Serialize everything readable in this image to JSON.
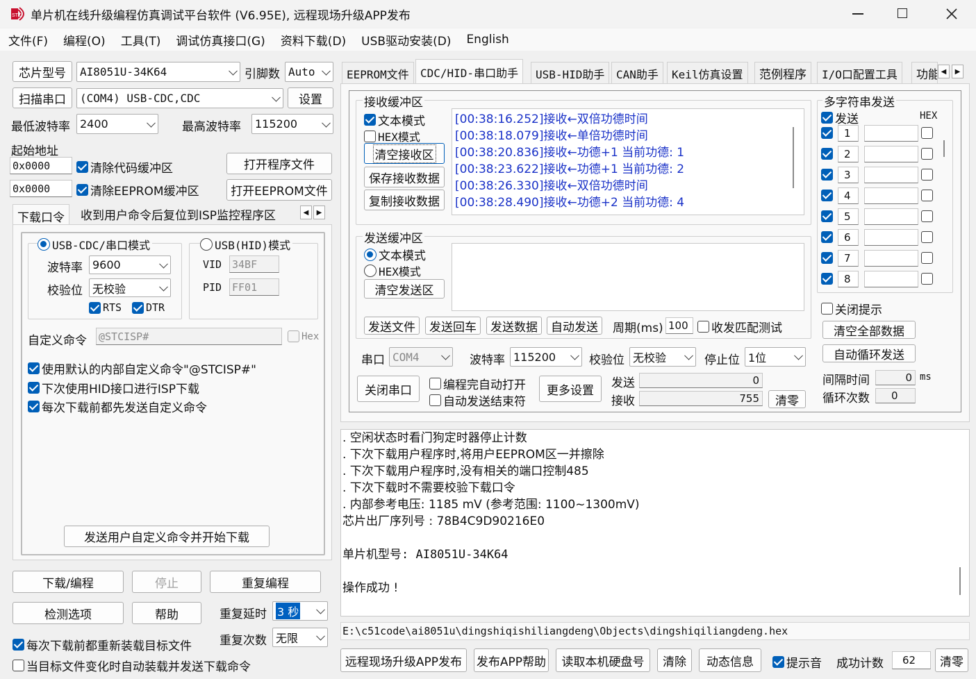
{
  "window": {
    "title": "单片机在线升级编程仿真调试平台软件 (V6.95E), 远程现场升级APP发布"
  },
  "menu": [
    "文件(F)",
    "编程(O)",
    "工具(T)",
    "调试仿真接口(G)",
    "资料下载(D)",
    "USB驱动安装(D)",
    "English"
  ],
  "left": {
    "chip_label": "芯片型号",
    "chip_value": "AI8051U-34K64",
    "pins_label": "引脚数",
    "pins_value": "Auto",
    "scan_btn": "扫描串口",
    "port_value": "(COM4) USB-CDC,CDC",
    "settings_btn": "设置",
    "min_baud_label": "最低波特率",
    "min_baud_value": "2400",
    "max_baud_label": "最高波特率",
    "max_baud_value": "115200",
    "start_addr_label": "起始地址",
    "addr1": "0x0000",
    "addr2": "0x0000",
    "clear_code": "清除代码缓冲区",
    "clear_eeprom": "清除EEPROM缓冲区",
    "open_prog_btn": "打开程序文件",
    "open_eeprom_btn": "打开EEPROM文件",
    "tabs": [
      "下载口令",
      "收到用户命令后复位到ISP监控程序区"
    ],
    "usb_cdc_mode": "USB-CDC/串口模式",
    "usb_hid_mode": "USB(HID)模式",
    "baud_label": "波特率",
    "baud_value": "9600",
    "parity_label": "校验位",
    "parity_value": "无校验",
    "rts": "RTS",
    "dtr": "DTR",
    "vid_label": "VID",
    "vid_value": "34BF",
    "pid_label": "PID",
    "pid_value": "FF01",
    "custom_cmd_label": "自定义命令",
    "custom_cmd_value": "@STCISP#",
    "hex_label": "Hex",
    "opt1": "使用默认的内部自定义命令\"@STCISP#\"",
    "opt2": "下次使用HID接口进行ISP下载",
    "opt3": "每次下载前都先发送自定义命令",
    "send_start_btn": "发送用户自定义命令并开始下载",
    "download_btn": "下载/编程",
    "stop_btn": "停止",
    "reprog_btn": "重复编程",
    "check_btn": "检测选项",
    "help_btn": "帮助",
    "repeat_delay_label": "重复延时",
    "repeat_delay_value": "3 秒",
    "repeat_count_label": "重复次数",
    "repeat_count_value": "无限",
    "reload_each": "每次下载前都重新装载目标文件",
    "auto_reload": "当目标文件变化时自动装载并发送下载命令"
  },
  "tabs": [
    "EEPROM文件",
    "CDC/HID-串口助手",
    "USB-HID助手",
    "CAN助手",
    "Keil仿真设置",
    "范例程序",
    "I/O口配置工具",
    "功能"
  ],
  "recv": {
    "title": "接收缓冲区",
    "text_mode": "文本模式",
    "hex_mode": "HEX模式",
    "clear_btn": "清空接收区",
    "save_btn": "保存接收数据",
    "copy_btn": "复制接收数据",
    "lines": [
      "[00:38:16.252]接收←双倍功德时间",
      "[00:38:18.079]接收←单倍功德时间",
      "[00:38:20.836]接收←功德+1 当前功德: 1",
      "[00:38:23.622]接收←功德+1 当前功德: 2",
      "[00:38:26.330]接收←双倍功德时间",
      "[00:38:28.490]接收←功德+2 当前功德: 4"
    ]
  },
  "send": {
    "title": "发送缓冲区",
    "text_mode": "文本模式",
    "hex_mode": "HEX模式",
    "clear_btn": "清空发送区",
    "send_file": "发送文件",
    "send_return": "发送回车",
    "send_data": "发送数据",
    "auto_send": "自动发送",
    "period_label": "周期(ms)",
    "period_value": "100",
    "match_test": "收发匹配测试"
  },
  "serial": {
    "port_label": "串口",
    "port_value": "COM4",
    "baud_label": "波特率",
    "baud_value": "115200",
    "parity_label": "校验位",
    "parity_value": "无校验",
    "stop_label": "停止位",
    "stop_value": "1位",
    "close_btn": "关闭串口",
    "auto_open": "编程完自动打开",
    "auto_end": "自动发送结束符",
    "more_btn": "更多设置",
    "tx_label": "发送",
    "tx_value": "0",
    "rx_label": "接收",
    "rx_value": "755",
    "clear_btn": "清零"
  },
  "multi": {
    "title": "多字符串发送",
    "send_label": "发送",
    "hex_label": "HEX",
    "rows": [
      "1",
      "2",
      "3",
      "4",
      "5",
      "6",
      "7",
      "8"
    ],
    "close_tip": "关闭提示",
    "clear_all": "清空全部数据",
    "auto_loop": "自动循环发送",
    "interval_label": "间隔时间",
    "interval_value": "0",
    "interval_unit": "ms",
    "loop_label": "循环次数",
    "loop_value": "0"
  },
  "log": {
    "lines": [
      "  .  空闲状态时看门狗定时器停止计数",
      "  .  下次下载用户程序时,将用户EEPROM区一并擦除",
      "  .  下次下载用户程序时,没有相关的端口控制485",
      "  .  下次下载时不需要校验下载口令",
      "  .  内部参考电压: 1185 mV (参考范围: 1100~1300mV)",
      "芯片出厂序列号 : 78B4C9D90216E0",
      "",
      "  单片机型号: AI8051U-34K64",
      "",
      "操作成功 !"
    ],
    "path": "E:\\c51code\\ai8051u\\dingshiqishiliangdeng\\Objects\\dingshiqiliangdeng.hex"
  },
  "bottom": {
    "publish_btn": "远程现场升级APP发布",
    "publish_help": "发布APP帮助",
    "read_disk": "读取本机硬盘号",
    "clear_btn": "清除",
    "dynamic_btn": "动态信息",
    "beep": "提示音",
    "success_label": "成功计数",
    "success_value": "62",
    "zero_btn": "清零"
  },
  "colors": {
    "accent": "#005fb8",
    "recv_text": "#1a32c8",
    "bg": "#f0f0f0"
  }
}
